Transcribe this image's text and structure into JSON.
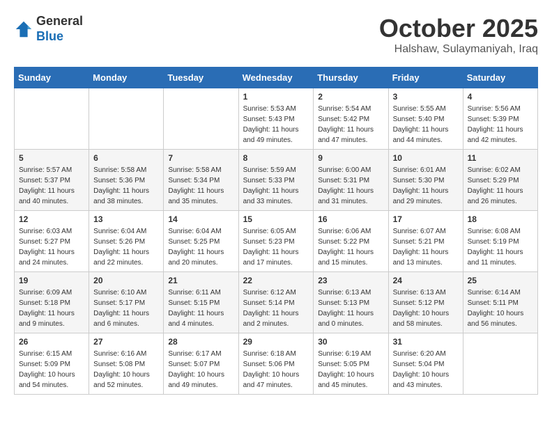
{
  "header": {
    "logo_line1": "General",
    "logo_line2": "Blue",
    "month": "October 2025",
    "location": "Halshaw, Sulaymaniyah, Iraq"
  },
  "weekdays": [
    "Sunday",
    "Monday",
    "Tuesday",
    "Wednesday",
    "Thursday",
    "Friday",
    "Saturday"
  ],
  "weeks": [
    [
      {
        "day": "",
        "info": ""
      },
      {
        "day": "",
        "info": ""
      },
      {
        "day": "",
        "info": ""
      },
      {
        "day": "1",
        "info": "Sunrise: 5:53 AM\nSunset: 5:43 PM\nDaylight: 11 hours\nand 49 minutes."
      },
      {
        "day": "2",
        "info": "Sunrise: 5:54 AM\nSunset: 5:42 PM\nDaylight: 11 hours\nand 47 minutes."
      },
      {
        "day": "3",
        "info": "Sunrise: 5:55 AM\nSunset: 5:40 PM\nDaylight: 11 hours\nand 44 minutes."
      },
      {
        "day": "4",
        "info": "Sunrise: 5:56 AM\nSunset: 5:39 PM\nDaylight: 11 hours\nand 42 minutes."
      }
    ],
    [
      {
        "day": "5",
        "info": "Sunrise: 5:57 AM\nSunset: 5:37 PM\nDaylight: 11 hours\nand 40 minutes."
      },
      {
        "day": "6",
        "info": "Sunrise: 5:58 AM\nSunset: 5:36 PM\nDaylight: 11 hours\nand 38 minutes."
      },
      {
        "day": "7",
        "info": "Sunrise: 5:58 AM\nSunset: 5:34 PM\nDaylight: 11 hours\nand 35 minutes."
      },
      {
        "day": "8",
        "info": "Sunrise: 5:59 AM\nSunset: 5:33 PM\nDaylight: 11 hours\nand 33 minutes."
      },
      {
        "day": "9",
        "info": "Sunrise: 6:00 AM\nSunset: 5:31 PM\nDaylight: 11 hours\nand 31 minutes."
      },
      {
        "day": "10",
        "info": "Sunrise: 6:01 AM\nSunset: 5:30 PM\nDaylight: 11 hours\nand 29 minutes."
      },
      {
        "day": "11",
        "info": "Sunrise: 6:02 AM\nSunset: 5:29 PM\nDaylight: 11 hours\nand 26 minutes."
      }
    ],
    [
      {
        "day": "12",
        "info": "Sunrise: 6:03 AM\nSunset: 5:27 PM\nDaylight: 11 hours\nand 24 minutes."
      },
      {
        "day": "13",
        "info": "Sunrise: 6:04 AM\nSunset: 5:26 PM\nDaylight: 11 hours\nand 22 minutes."
      },
      {
        "day": "14",
        "info": "Sunrise: 6:04 AM\nSunset: 5:25 PM\nDaylight: 11 hours\nand 20 minutes."
      },
      {
        "day": "15",
        "info": "Sunrise: 6:05 AM\nSunset: 5:23 PM\nDaylight: 11 hours\nand 17 minutes."
      },
      {
        "day": "16",
        "info": "Sunrise: 6:06 AM\nSunset: 5:22 PM\nDaylight: 11 hours\nand 15 minutes."
      },
      {
        "day": "17",
        "info": "Sunrise: 6:07 AM\nSunset: 5:21 PM\nDaylight: 11 hours\nand 13 minutes."
      },
      {
        "day": "18",
        "info": "Sunrise: 6:08 AM\nSunset: 5:19 PM\nDaylight: 11 hours\nand 11 minutes."
      }
    ],
    [
      {
        "day": "19",
        "info": "Sunrise: 6:09 AM\nSunset: 5:18 PM\nDaylight: 11 hours\nand 9 minutes."
      },
      {
        "day": "20",
        "info": "Sunrise: 6:10 AM\nSunset: 5:17 PM\nDaylight: 11 hours\nand 6 minutes."
      },
      {
        "day": "21",
        "info": "Sunrise: 6:11 AM\nSunset: 5:15 PM\nDaylight: 11 hours\nand 4 minutes."
      },
      {
        "day": "22",
        "info": "Sunrise: 6:12 AM\nSunset: 5:14 PM\nDaylight: 11 hours\nand 2 minutes."
      },
      {
        "day": "23",
        "info": "Sunrise: 6:13 AM\nSunset: 5:13 PM\nDaylight: 11 hours\nand 0 minutes."
      },
      {
        "day": "24",
        "info": "Sunrise: 6:13 AM\nSunset: 5:12 PM\nDaylight: 10 hours\nand 58 minutes."
      },
      {
        "day": "25",
        "info": "Sunrise: 6:14 AM\nSunset: 5:11 PM\nDaylight: 10 hours\nand 56 minutes."
      }
    ],
    [
      {
        "day": "26",
        "info": "Sunrise: 6:15 AM\nSunset: 5:09 PM\nDaylight: 10 hours\nand 54 minutes."
      },
      {
        "day": "27",
        "info": "Sunrise: 6:16 AM\nSunset: 5:08 PM\nDaylight: 10 hours\nand 52 minutes."
      },
      {
        "day": "28",
        "info": "Sunrise: 6:17 AM\nSunset: 5:07 PM\nDaylight: 10 hours\nand 49 minutes."
      },
      {
        "day": "29",
        "info": "Sunrise: 6:18 AM\nSunset: 5:06 PM\nDaylight: 10 hours\nand 47 minutes."
      },
      {
        "day": "30",
        "info": "Sunrise: 6:19 AM\nSunset: 5:05 PM\nDaylight: 10 hours\nand 45 minutes."
      },
      {
        "day": "31",
        "info": "Sunrise: 6:20 AM\nSunset: 5:04 PM\nDaylight: 10 hours\nand 43 minutes."
      },
      {
        "day": "",
        "info": ""
      }
    ]
  ]
}
